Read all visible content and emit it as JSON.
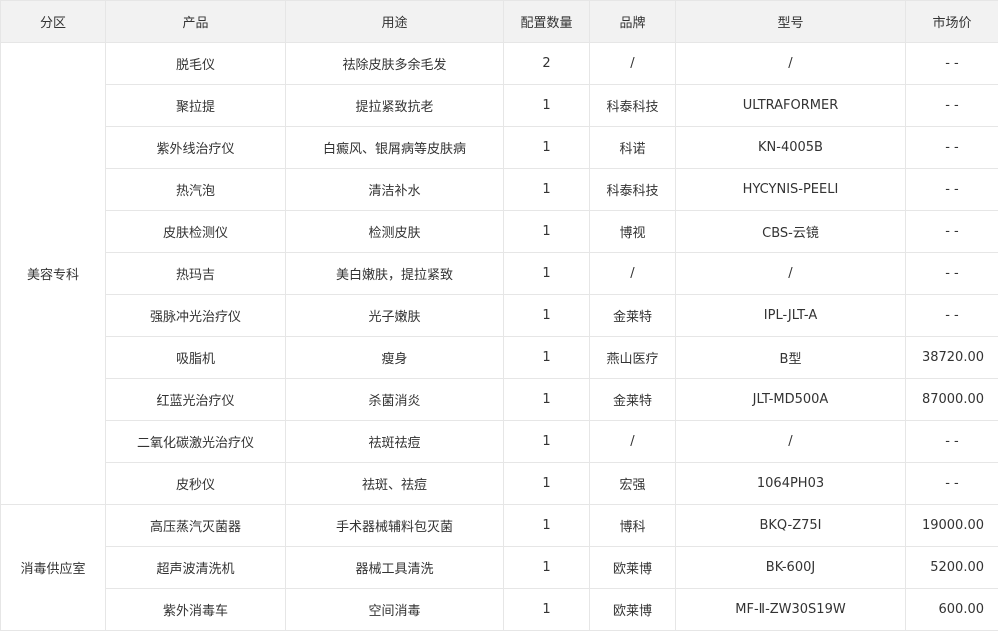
{
  "table": {
    "headers": [
      "分区",
      "产品",
      "用途",
      "配置数量",
      "品牌",
      "型号",
      "市场价"
    ],
    "zones": [
      {
        "name": "美容专科",
        "rows": [
          {
            "product": "脱毛仪",
            "usage": "祛除皮肤多余毛发",
            "qty": "2",
            "brand": "/",
            "model": "/",
            "price": "- -"
          },
          {
            "product": "聚拉提",
            "usage": "提拉紧致抗老",
            "qty": "1",
            "brand": "科泰科技",
            "model": "ULTRAFORMER",
            "price": "- -"
          },
          {
            "product": "紫外线治疗仪",
            "usage": "白癜风、银屑病等皮肤病",
            "qty": "1",
            "brand": "科诺",
            "model": "KN-4005B",
            "price": "- -"
          },
          {
            "product": "热汽泡",
            "usage": "清洁补水",
            "qty": "1",
            "brand": "科泰科技",
            "model": "HYCYNIS-PEELI",
            "price": "- -"
          },
          {
            "product": "皮肤检测仪",
            "usage": "检测皮肤",
            "qty": "1",
            "brand": "博视",
            "model": "CBS-云镜",
            "price": "- -"
          },
          {
            "product": "热玛吉",
            "usage": "美白嫩肤，提拉紧致",
            "qty": "1",
            "brand": "/",
            "model": "/",
            "price": "- -"
          },
          {
            "product": "强脉冲光治疗仪",
            "usage": "光子嫩肤",
            "qty": "1",
            "brand": "金莱特",
            "model": "IPL-JLT-A",
            "price": "- -"
          },
          {
            "product": "吸脂机",
            "usage": "瘦身",
            "qty": "1",
            "brand": "燕山医疗",
            "model": "B型",
            "price": "38720.00"
          },
          {
            "product": "红蓝光治疗仪",
            "usage": "杀菌消炎",
            "qty": "1",
            "brand": "金莱特",
            "model": "JLT-MD500A",
            "price": "87000.00"
          },
          {
            "product": "二氧化碳激光治疗仪",
            "usage": "祛斑祛痘",
            "qty": "1",
            "brand": "/",
            "model": "/",
            "price": "- -"
          },
          {
            "product": "皮秒仪",
            "usage": "祛斑、祛痘",
            "qty": "1",
            "brand": "宏强",
            "model": "1064PH03",
            "price": "- -"
          }
        ]
      },
      {
        "name": "消毒供应室",
        "rows": [
          {
            "product": "高压蒸汽灭菌器",
            "usage": "手术器械辅料包灭菌",
            "qty": "1",
            "brand": "博科",
            "model": "BKQ-Z75I",
            "price": "19000.00"
          },
          {
            "product": "超声波清洗机",
            "usage": "器械工具清洗",
            "qty": "1",
            "brand": "欧莱博",
            "model": "BK-600J",
            "price": "5200.00"
          },
          {
            "product": "紫外消毒车",
            "usage": "空间消毒",
            "qty": "1",
            "brand": "欧莱博",
            "model": "MF-Ⅱ-ZW30S19W",
            "price": "600.00"
          }
        ]
      }
    ]
  }
}
